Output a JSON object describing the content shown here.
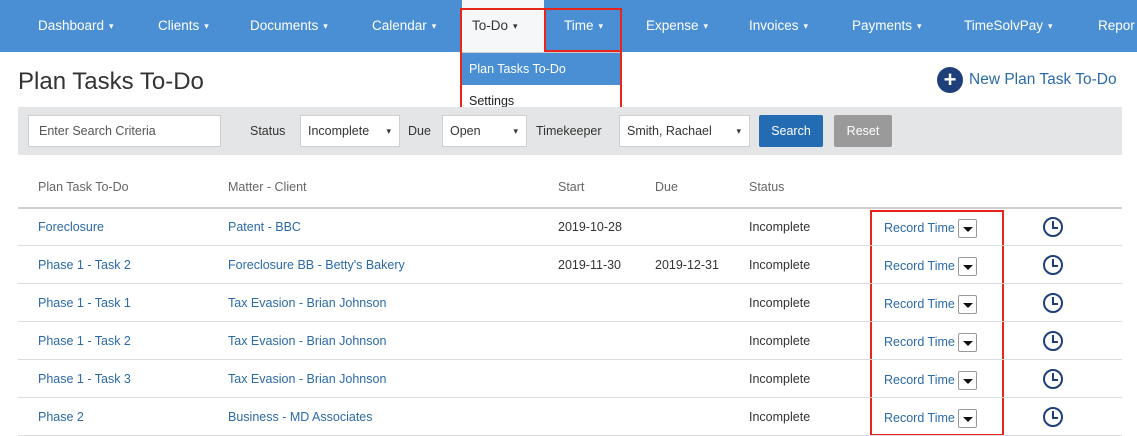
{
  "nav": {
    "items": [
      {
        "label": "Dashboard"
      },
      {
        "label": "Clients"
      },
      {
        "label": "Documents"
      },
      {
        "label": "Calendar"
      },
      {
        "label": "To-Do"
      },
      {
        "label": "Time"
      },
      {
        "label": "Expense"
      },
      {
        "label": "Invoices"
      },
      {
        "label": "Payments"
      },
      {
        "label": "TimeSolvPay"
      },
      {
        "label": "Repor"
      }
    ],
    "caret": "▾",
    "dropdown": [
      {
        "label": "Plan Tasks To-Do",
        "selected": true
      },
      {
        "label": "Settings",
        "selected": false
      }
    ]
  },
  "page": {
    "title": "Plan Tasks To-Do",
    "new_button_label": "New Plan Task To-Do"
  },
  "filters": {
    "search_placeholder": "Enter Search Criteria",
    "status_label": "Status",
    "status_value": "Incomplete",
    "due_label": "Due",
    "due_value": "Open",
    "timekeeper_label": "Timekeeper",
    "timekeeper_value": "Smith, Rachael",
    "search_button": "Search",
    "reset_button": "Reset"
  },
  "table": {
    "columns": [
      "Plan Task To-Do",
      "Matter - Client",
      "Start",
      "Due",
      "Status"
    ],
    "record_time_label": "Record Time",
    "rows": [
      {
        "task": "Foreclosure",
        "matter": "Patent - BBC",
        "start": "2019-10-28",
        "due": "",
        "status": "Incomplete"
      },
      {
        "task": "Phase 1 - Task 2",
        "matter": "Foreclosure BB - Betty's Bakery",
        "start": "2019-11-30",
        "due": "2019-12-31",
        "status": "Incomplete"
      },
      {
        "task": "Phase 1 - Task 1",
        "matter": "Tax Evasion - Brian Johnson",
        "start": "",
        "due": "",
        "status": "Incomplete"
      },
      {
        "task": "Phase 1 - Task 2",
        "matter": "Tax Evasion - Brian Johnson",
        "start": "",
        "due": "",
        "status": "Incomplete"
      },
      {
        "task": "Phase 1 - Task 3",
        "matter": "Tax Evasion - Brian Johnson",
        "start": "",
        "due": "",
        "status": "Incomplete"
      },
      {
        "task": "Phase 2",
        "matter": "Business - MD Associates",
        "start": "",
        "due": "",
        "status": "Incomplete"
      }
    ]
  },
  "colors": {
    "nav_background": "#4a8fd3",
    "link": "#2a6aa9",
    "primary_button": "#236bb3",
    "highlight_box": "#e8241b"
  }
}
